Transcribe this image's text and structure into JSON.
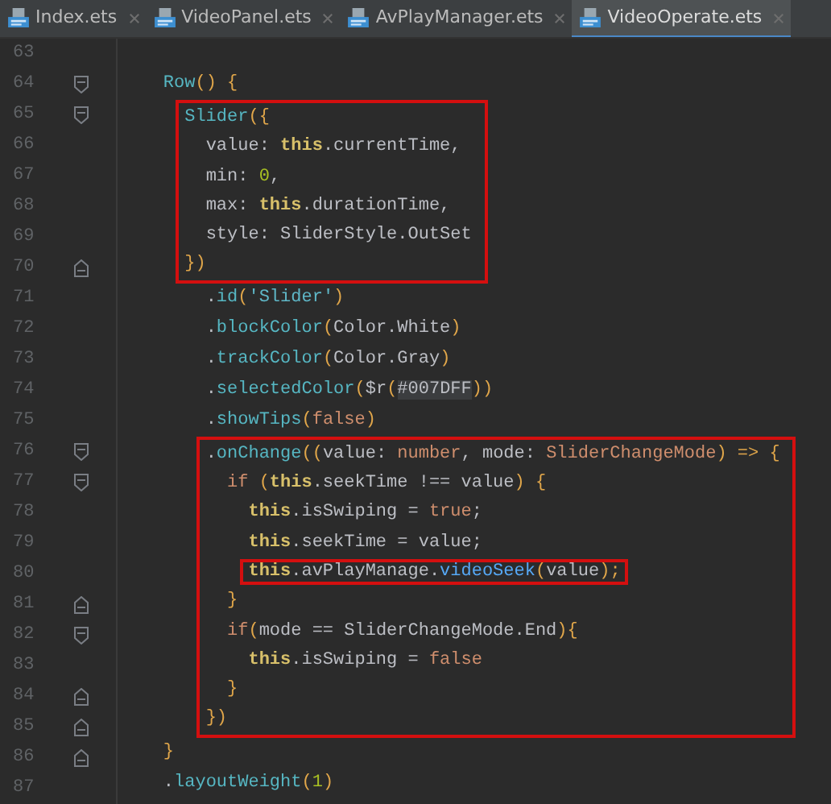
{
  "tabs": [
    {
      "label": "Index.ets",
      "selected": false
    },
    {
      "label": "VideoPanel.ets",
      "selected": false
    },
    {
      "label": "AvPlayManager.ets",
      "selected": false
    },
    {
      "label": "VideoOperate.ets",
      "selected": true
    }
  ],
  "code_segments": [
    {
      "highlighted": false,
      "lines": [
        {
          "number": "63"
        },
        {
          "number": "64",
          "kind": "fold_start",
          "tokens": [
            {
              "text": "    Row",
              "kind": "fn"
            },
            {
              "text": "() {",
              "kind": "punc"
            }
          ]
        }
      ]
    },
    {
      "highlighted": true,
      "lines": [
        {
          "number": "65",
          "kind": "fold_start",
          "tokens": [
            {
              "text": "      Slider",
              "kind": "fn"
            },
            {
              "text": "({",
              "kind": "punc"
            }
          ]
        },
        {
          "number": "66",
          "tokens": [
            {
              "text": "        value: ",
              "kind": "plain"
            },
            {
              "text": "this",
              "kind": "this"
            },
            {
              "text": ".currentTime,",
              "kind": "plain"
            }
          ]
        },
        {
          "number": "67",
          "tokens": [
            {
              "text": "        min: ",
              "kind": "plain"
            },
            {
              "text": "0",
              "kind": "num"
            },
            {
              "text": ",",
              "kind": "plain"
            }
          ]
        },
        {
          "number": "68",
          "tokens": [
            {
              "text": "        max: ",
              "kind": "plain"
            },
            {
              "text": "this",
              "kind": "this"
            },
            {
              "text": ".durationTime,",
              "kind": "plain"
            }
          ]
        },
        {
          "number": "69",
          "tokens": [
            {
              "text": "        style: SliderStyle.OutSet",
              "kind": "plain"
            }
          ]
        },
        {
          "number": "70",
          "kind": "fold_end",
          "tokens": [
            {
              "text": "      })",
              "kind": "punc"
            }
          ]
        }
      ]
    },
    {
      "highlighted": false,
      "lines": [
        {
          "number": "71",
          "tokens": [
            {
              "text": "        .",
              "kind": "plain"
            },
            {
              "text": "id",
              "kind": "fn"
            },
            {
              "text": "(",
              "kind": "punc"
            },
            {
              "text": "'Slider'",
              "kind": "str"
            },
            {
              "text": ")",
              "kind": "punc"
            }
          ]
        },
        {
          "number": "72",
          "tokens": [
            {
              "text": "        .",
              "kind": "plain"
            },
            {
              "text": "blockColor",
              "kind": "fn"
            },
            {
              "text": "(",
              "kind": "punc"
            },
            {
              "text": "Color.White",
              "kind": "plain"
            },
            {
              "text": ")",
              "kind": "punc"
            }
          ]
        },
        {
          "number": "73",
          "tokens": [
            {
              "text": "        .",
              "kind": "plain"
            },
            {
              "text": "trackColor",
              "kind": "fn"
            },
            {
              "text": "(",
              "kind": "punc"
            },
            {
              "text": "Color.Gray",
              "kind": "plain"
            },
            {
              "text": ")",
              "kind": "punc"
            }
          ]
        },
        {
          "number": "74",
          "tokens": [
            {
              "text": "        .",
              "kind": "plain"
            },
            {
              "text": "selectedColor",
              "kind": "fn"
            },
            {
              "text": "(",
              "kind": "punc"
            },
            {
              "text": "$r",
              "kind": "plain"
            },
            {
              "text": "(",
              "kind": "punc"
            },
            {
              "text": "#007DFF",
              "kind": "hex"
            },
            {
              "text": "))",
              "kind": "punc"
            }
          ]
        },
        {
          "number": "75",
          "tokens": [
            {
              "text": "        .",
              "kind": "plain"
            },
            {
              "text": "showTips",
              "kind": "fn"
            },
            {
              "text": "(",
              "kind": "punc"
            },
            {
              "text": "false",
              "kind": "kw"
            },
            {
              "text": ")",
              "kind": "punc"
            }
          ]
        }
      ]
    },
    {
      "highlighted": true,
      "lines": [
        {
          "number": "76",
          "kind": "fold_start",
          "tokens": [
            {
              "text": "        .",
              "kind": "plain"
            },
            {
              "text": "onChange",
              "kind": "fn"
            },
            {
              "text": "((",
              "kind": "punc"
            },
            {
              "text": "value: ",
              "kind": "plain"
            },
            {
              "text": "number",
              "kind": "kw"
            },
            {
              "text": ", mode: ",
              "kind": "plain"
            },
            {
              "text": "SliderChangeMode",
              "kind": "kw"
            },
            {
              "text": ") => {",
              "kind": "punc"
            }
          ]
        },
        {
          "number": "77",
          "kind": "fold_start",
          "tokens": [
            {
              "text": "          if",
              "kind": "kw"
            },
            {
              "text": " (",
              "kind": "punc"
            },
            {
              "text": "this",
              "kind": "this"
            },
            {
              "text": ".seekTime !== value",
              "kind": "plain"
            },
            {
              "text": ") {",
              "kind": "punc"
            }
          ]
        },
        {
          "number": "78",
          "tokens": [
            {
              "text": "            this",
              "kind": "this"
            },
            {
              "text": ".isSwiping = ",
              "kind": "plain"
            },
            {
              "text": "true",
              "kind": "kw"
            },
            {
              "text": ";",
              "kind": "plain"
            }
          ]
        },
        {
          "number": "79",
          "tokens": [
            {
              "text": "            this",
              "kind": "this"
            },
            {
              "text": ".seekTime = value;",
              "kind": "plain"
            }
          ]
        },
        {
          "number": "80",
          "highlighted": true,
          "tokens": [
            {
              "text": "            this",
              "kind": "this"
            },
            {
              "text": ".avPlayManage.",
              "kind": "plain"
            },
            {
              "text": "videoSeek",
              "kind": "call"
            },
            {
              "text": "(",
              "kind": "punc"
            },
            {
              "text": "value",
              "kind": "plain"
            },
            {
              "text": ");",
              "kind": "punc"
            }
          ]
        },
        {
          "number": "81",
          "kind": "fold_end",
          "tokens": [
            {
              "text": "          }",
              "kind": "punc"
            }
          ]
        },
        {
          "number": "82",
          "kind": "fold_start",
          "tokens": [
            {
              "text": "          if",
              "kind": "kw"
            },
            {
              "text": "(",
              "kind": "punc"
            },
            {
              "text": "mode == SliderChangeMode.End",
              "kind": "plain"
            },
            {
              "text": "){",
              "kind": "punc"
            }
          ]
        },
        {
          "number": "83",
          "tokens": [
            {
              "text": "            this",
              "kind": "this"
            },
            {
              "text": ".isSwiping = ",
              "kind": "plain"
            },
            {
              "text": "false",
              "kind": "kw"
            }
          ]
        },
        {
          "number": "84",
          "kind": "fold_end",
          "tokens": [
            {
              "text": "          }",
              "kind": "punc"
            }
          ]
        },
        {
          "number": "85",
          "kind": "fold_end",
          "tokens": [
            {
              "text": "        })",
              "kind": "punc"
            }
          ]
        }
      ]
    },
    {
      "highlighted": false,
      "lines": [
        {
          "number": "86",
          "kind": "fold_end",
          "tokens": [
            {
              "text": "    }",
              "kind": "punc"
            }
          ]
        },
        {
          "number": "87",
          "tokens": [
            {
              "text": "    .",
              "kind": "plain"
            },
            {
              "text": "layoutWeight",
              "kind": "fn"
            },
            {
              "text": "(",
              "kind": "punc"
            },
            {
              "text": "1",
              "kind": "num"
            },
            {
              "text": ")",
              "kind": "punc"
            }
          ]
        }
      ]
    }
  ]
}
